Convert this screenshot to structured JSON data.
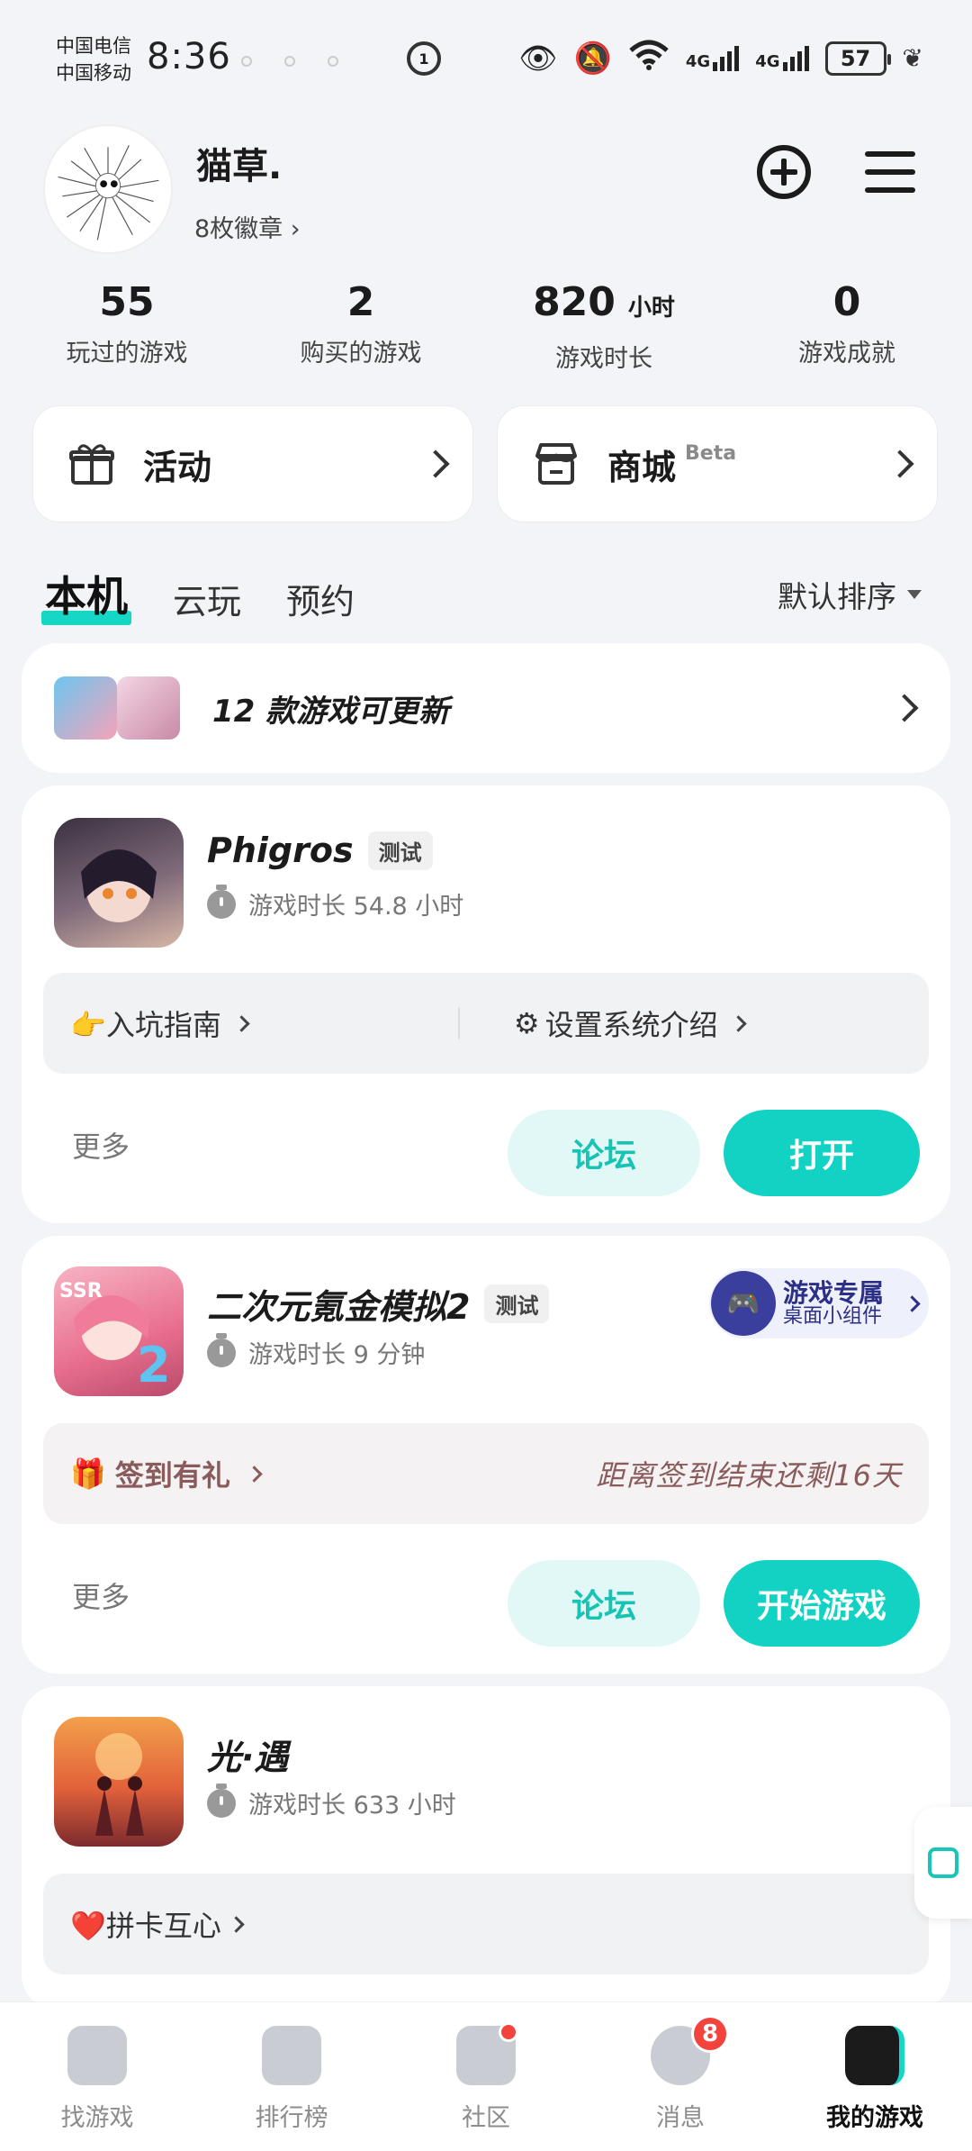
{
  "status_bar": {
    "carrier1": "中国电信",
    "carrier2": "中国移动",
    "time": "8:36",
    "badge": "1",
    "net1": "4G",
    "net2": "4G",
    "battery": "57"
  },
  "profile": {
    "username": "猫草.",
    "badges": "8枚徽章 ›"
  },
  "stats": [
    {
      "value": "55",
      "unit": "",
      "label": "玩过的游戏"
    },
    {
      "value": "2",
      "unit": "",
      "label": "购买的游戏"
    },
    {
      "value": "820",
      "unit": "小时",
      "label": "游戏时长"
    },
    {
      "value": "0",
      "unit": "",
      "label": "游戏成就"
    }
  ],
  "entries": {
    "activity": "活动",
    "shop": "商城",
    "shop_tag": "Beta"
  },
  "tabs": {
    "local": "本机",
    "cloud": "云玩",
    "reserve": "预约",
    "sort": "默认排序"
  },
  "update": {
    "text": "12 款游戏可更新"
  },
  "games": [
    {
      "title": "Phigros",
      "tag": "测试",
      "time": "游戏时长 54.8 小时",
      "link1": "👉入坑指南",
      "link2": "设置系统介绍",
      "more": "更多",
      "forum": "论坛",
      "action": "打开"
    },
    {
      "title": "二次元氪金模拟2",
      "tag": "测试",
      "time": "游戏时长 9 分钟",
      "widget_title": "游戏专属",
      "widget_sub": "桌面小组件",
      "signin": "签到有礼",
      "signin_info": "距离签到结束还剩16天",
      "more": "更多",
      "forum": "论坛",
      "action": "开始游戏"
    },
    {
      "title": "光·遇",
      "time": "游戏时长 633 小时",
      "link1": "❤️拼卡互心"
    }
  ],
  "nav": {
    "find": "找游戏",
    "rank": "排行榜",
    "community": "社区",
    "messages": "消息",
    "messages_count": "8",
    "mine": "我的游戏"
  },
  "colors": {
    "accent": "#12d3c3",
    "background": "#f3f4f7",
    "badge_red": "#f2433d"
  }
}
